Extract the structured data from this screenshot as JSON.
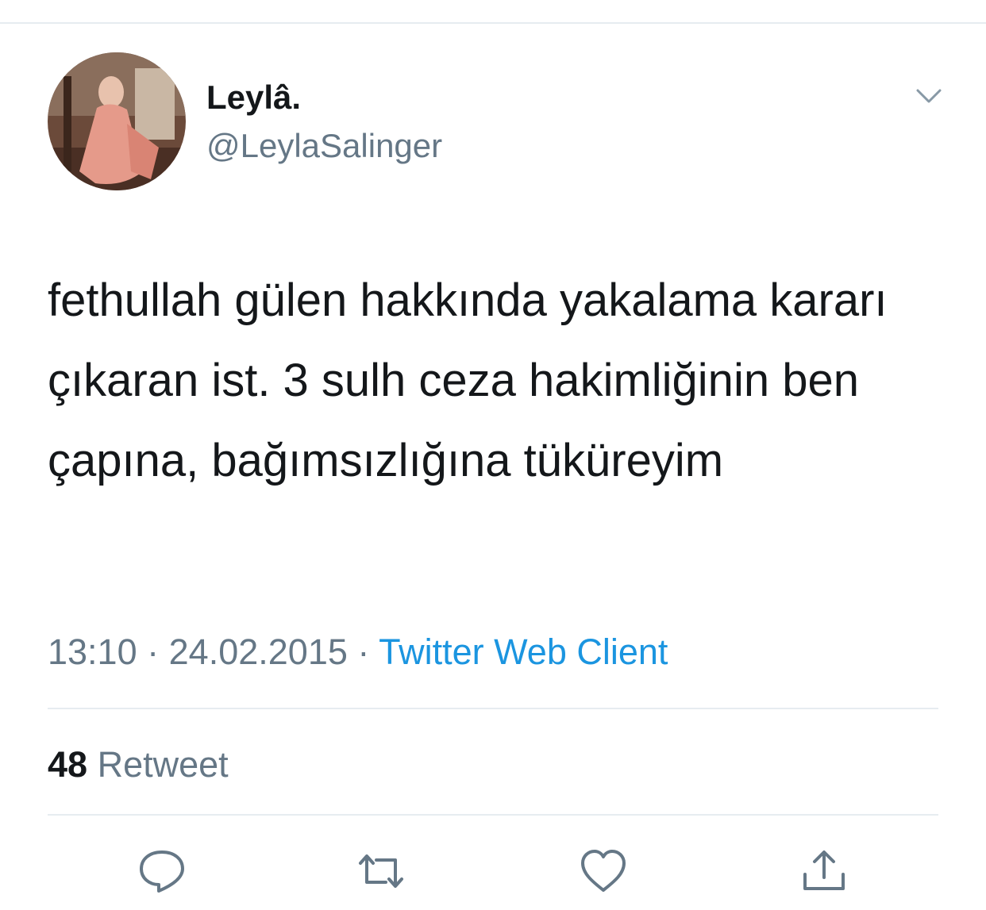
{
  "tweet": {
    "user": {
      "display_name": "Leylâ.",
      "handle": "@LeylaSalinger",
      "avatar_icon": "profile-photo"
    },
    "text": "fethullah gülen hakkında yakalama kararı çıkaran ist. 3 sulh ceza hakimliğinin ben çapına, bağımsızlığına tüküreyim",
    "time": "13:10",
    "separator": "·",
    "date": "24.02.2015",
    "source": "Twitter Web Client",
    "retweet_count": "48",
    "retweet_label": "Retweet"
  },
  "actions": {
    "reply_icon": "reply-icon",
    "retweet_icon": "retweet-icon",
    "like_icon": "heart-icon",
    "share_icon": "share-icon",
    "menu_icon": "chevron-down-icon"
  },
  "colors": {
    "text_primary": "#14171a",
    "text_secondary": "#657786",
    "link": "#1b95e0",
    "divider": "#e6ecf0"
  }
}
